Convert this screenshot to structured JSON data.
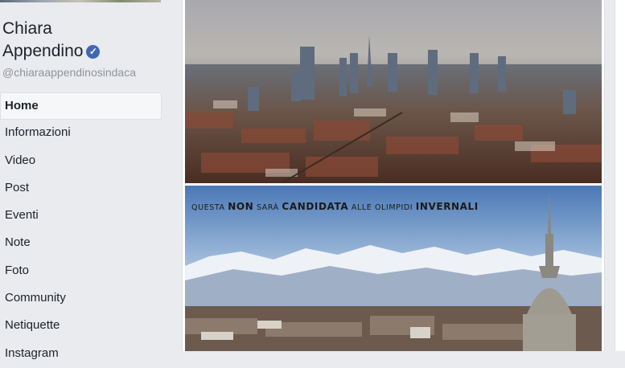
{
  "page": {
    "name_line1": "Chiara",
    "name_line2": "Appendino",
    "verified_mark": "✓",
    "handle": "@chiaraappendinosindaca"
  },
  "nav": {
    "items": [
      {
        "label": "Home",
        "active": true
      },
      {
        "label": "Informazioni"
      },
      {
        "label": "Video"
      },
      {
        "label": "Post"
      },
      {
        "label": "Eventi"
      },
      {
        "label": "Note"
      },
      {
        "label": "Foto"
      },
      {
        "label": "Community"
      },
      {
        "label": "Netiquette"
      },
      {
        "label": "Instagram"
      }
    ]
  },
  "post": {
    "caption_part1": "QUESTA ",
    "caption_bold1": "NON",
    "caption_part2": " SARÀ ",
    "caption_bold2": "CANDIDATA",
    "caption_part3": " ALLE OLIMPIDI ",
    "caption_bold3": "INVERNALI"
  },
  "colors": {
    "brand": "#4267b2",
    "background": "#e9ebee",
    "text": "#1d2129",
    "muted": "#90949c"
  }
}
